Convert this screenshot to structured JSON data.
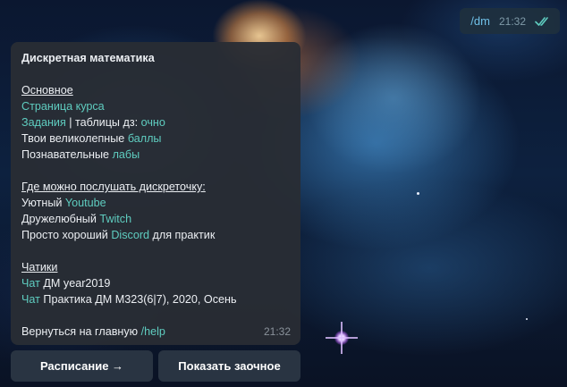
{
  "outgoing": {
    "text": "/dm",
    "time": "21:32"
  },
  "incoming": {
    "title": "Дискретная математика",
    "section_main": "Основное",
    "course_page": "Страница курса",
    "tasks": "Задания",
    "tables_text": " | таблицы дз: ",
    "tables_link": "очно",
    "scores_text": "Твои великолепные ",
    "scores_link": "баллы",
    "labs_text": "Познавательные ",
    "labs_link": "лабы",
    "section_listen": "Где можно послушать дискреточку:",
    "youtube_text": "Уютный ",
    "youtube_link": "Youtube",
    "twitch_text": "Дружелюбный ",
    "twitch_link": "Twitch",
    "discord_text": "Просто хороший ",
    "discord_link": "Discord",
    "discord_suffix": " для практик",
    "section_chats": "Чатики",
    "chat1_link": "Чат",
    "chat1_text": " ДМ year2019",
    "chat2_link": "Чат",
    "chat2_text": " Практика ДМ M323(6|7), 2020, Осень",
    "back_text": "Вернуться на главную ",
    "back_link": "/help",
    "time": "21:32"
  },
  "keyboard": {
    "schedule_label": "Расписание →",
    "show_remote_label": "Показать заочное"
  },
  "colors": {
    "link": "#5fcdc0",
    "outgoing_text": "#6fc0e8",
    "bubble": "#292d34"
  }
}
